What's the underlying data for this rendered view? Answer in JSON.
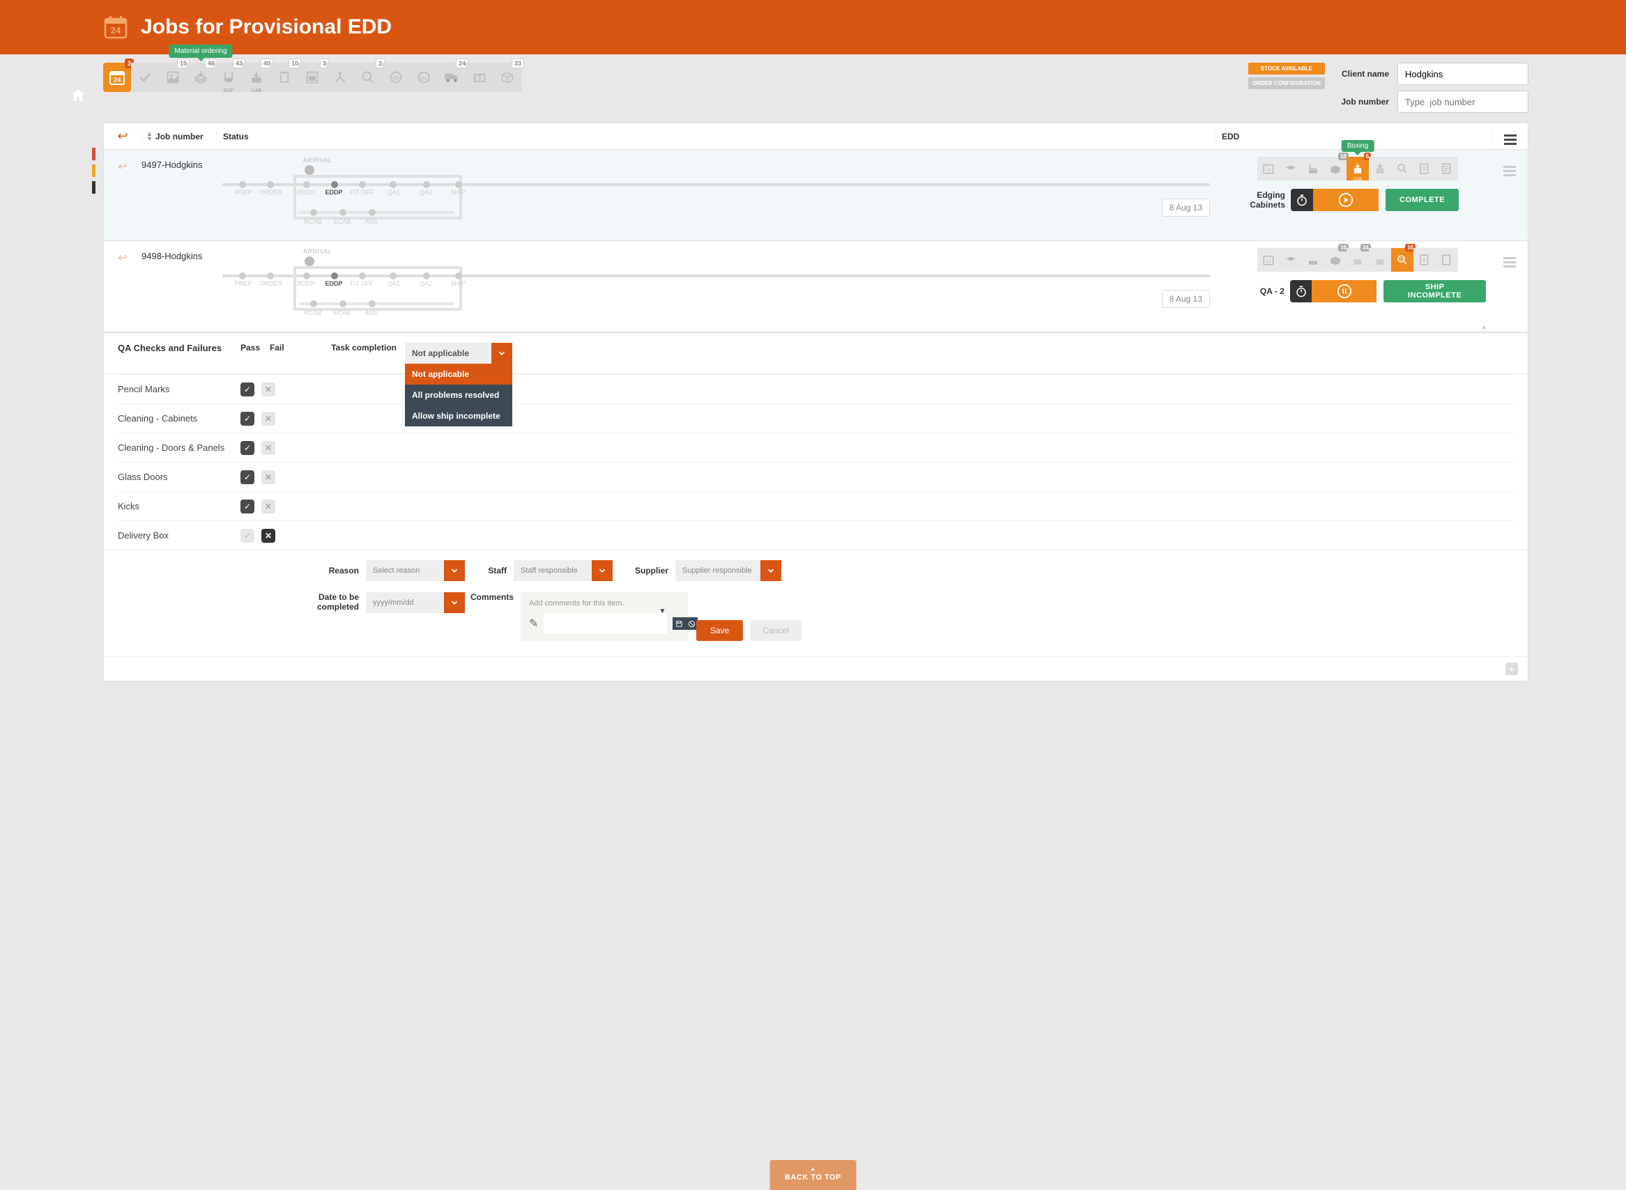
{
  "header": {
    "title": "Jobs for Provisional EDD"
  },
  "filters": {
    "client_name_label": "Client name",
    "client_name_value": "Hodgkins",
    "job_number_label": "Job number",
    "job_number_placeholder": "Type  job number",
    "stock_btn": "STOCK AVAILABLE",
    "order_config_btn": "ORDER CONFIGURATION",
    "tooltip_material": "Material  ordering"
  },
  "stage_badges": [
    "2",
    "15",
    "46",
    "43",
    "40",
    "10",
    "3",
    "2",
    "",
    "",
    "24",
    "",
    "33"
  ],
  "columns": {
    "job": "Job number",
    "status": "Status",
    "edd": "EDD"
  },
  "flow_labels": {
    "arrival": "ARRIVAL",
    "top": [
      "PREP",
      "ORDER",
      "RDDP",
      "EDDP",
      "FIT OFF",
      "QA1",
      "QA2",
      "SHIP"
    ],
    "bottom": [
      "RCAB",
      "ECAB",
      "ASS"
    ]
  },
  "jobs": [
    {
      "number": "9497-Hodgkins",
      "date": "8 Aug 13",
      "edd_tooltip": "Boxing",
      "edd_action_label": "Edging Cabinets",
      "edd_action_btn": "COMPLETE",
      "edd_badges": [
        "",
        "",
        "",
        "10",
        "6",
        "",
        "",
        "",
        ""
      ],
      "edd_active_index": 4,
      "edd_active_sublabel": "CAB"
    },
    {
      "number": "9498-Hodgkins",
      "date": "8 Aug 13",
      "edd_action_label": "QA - 2",
      "edd_action_btn": "SHIP INCOMPLETE",
      "edd_badges": [
        "",
        "",
        "",
        "10",
        "24",
        "",
        "10",
        "",
        ""
      ],
      "edd_active_index": 6
    }
  ],
  "qa": {
    "title": "QA Checks and Failures",
    "pass": "Pass",
    "fail": "Fail",
    "task_completion_label": "Task completion",
    "task_completion_value": "Not applicable",
    "task_completion_options": [
      "Not applicable",
      "All problems resolved",
      "Allow ship incomplete"
    ],
    "items": [
      {
        "label": "Pencil Marks",
        "pass": true
      },
      {
        "label": "Cleaning - Cabinets",
        "pass": true
      },
      {
        "label": "Cleaning - Doors & Panels",
        "pass": true
      },
      {
        "label": "Glass Doors",
        "pass": true
      },
      {
        "label": "Kicks",
        "pass": true
      },
      {
        "label": "Delivery Box",
        "pass": false
      }
    ],
    "fail_detail": {
      "reason_label": "Reason",
      "reason_ph": "Select reason",
      "staff_label": "Staff",
      "staff_ph": "Staff responsible",
      "supplier_label": "Supplier",
      "supplier_ph": "Supplier responsible",
      "date_label": "Date to be completed",
      "date_ph": "yyyy/mm/dd",
      "comments_label": "Comments",
      "comments_ph": "Add comments for this item.",
      "save": "Save",
      "cancel": "Cancel"
    }
  },
  "back_to_top": "BACK TO TOP"
}
